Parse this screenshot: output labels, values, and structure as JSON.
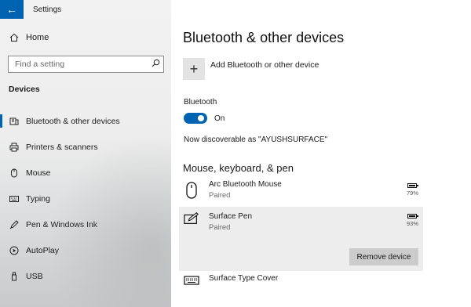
{
  "window": {
    "title": "Settings"
  },
  "sidebar": {
    "home_label": "Home",
    "search_placeholder": "Find a setting",
    "section_label": "Devices",
    "items": [
      {
        "label": "Bluetooth & other devices",
        "icon": "bluetooth-devices-icon",
        "active": true
      },
      {
        "label": "Printers & scanners",
        "icon": "printer-icon",
        "active": false
      },
      {
        "label": "Mouse",
        "icon": "mouse-icon",
        "active": false
      },
      {
        "label": "Typing",
        "icon": "keyboard-icon",
        "active": false
      },
      {
        "label": "Pen & Windows Ink",
        "icon": "pen-icon",
        "active": false
      },
      {
        "label": "AutoPlay",
        "icon": "autoplay-icon",
        "active": false
      },
      {
        "label": "USB",
        "icon": "usb-icon",
        "active": false
      }
    ]
  },
  "main": {
    "title": "Bluetooth & other devices",
    "add_device_label": "Add Bluetooth or other device",
    "bluetooth_label": "Bluetooth",
    "bluetooth_state": "On",
    "bluetooth_on": true,
    "discoverable_text": "Now discoverable as \"AYUSHSURFACE\"",
    "section_title": "Mouse, keyboard, & pen",
    "devices": [
      {
        "name": "Arc Bluetooth Mouse",
        "status": "Paired",
        "battery": "79%",
        "icon": "mouse-icon"
      },
      {
        "name": "Surface Pen",
        "status": "Paired",
        "battery": "93%",
        "icon": "pen-tablet-icon",
        "selected": true,
        "action_label": "Remove device"
      },
      {
        "name": "Surface Type Cover",
        "status": "",
        "battery": "",
        "icon": "keyboard-icon"
      }
    ]
  },
  "colors": {
    "accent": "#0063b1",
    "selected_row": "#ededed",
    "button": "#cccccc"
  }
}
